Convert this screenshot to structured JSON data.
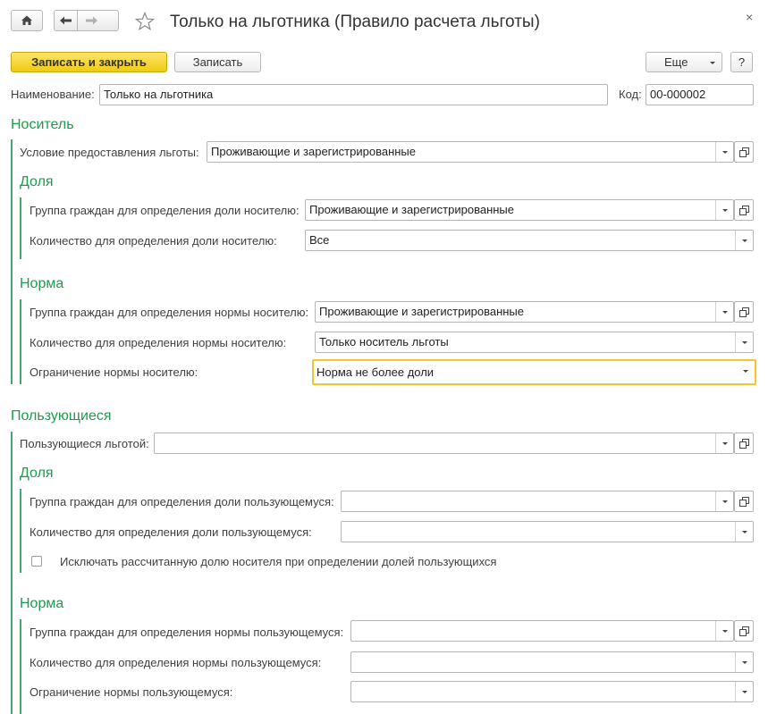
{
  "window": {
    "title": "Только на льготника (Правило расчета льготы)",
    "close_glyph": "×"
  },
  "toolbar": {
    "save_close_label": "Записать и закрыть",
    "save_label": "Записать",
    "more_label": "Еще",
    "help_label": "?"
  },
  "header_fields": {
    "name_label": "Наименование:",
    "name_value": "Только на льготника",
    "code_label": "Код:",
    "code_value": "00-000002"
  },
  "carrier": {
    "section_title": "Носитель",
    "condition_label": "Условие предоставления льготы:",
    "condition_value": "Проживающие и зарегистрированные",
    "share": {
      "title": "Доля",
      "group_label": "Группа граждан для определения доли носителю:",
      "group_value": "Проживающие и зарегистрированные",
      "count_label": "Количество для определения доли носителю:",
      "count_value": "Все"
    },
    "norm": {
      "title": "Норма",
      "group_label": "Группа граждан для определения нормы носителю:",
      "group_value": "Проживающие и зарегистрированные",
      "count_label": "Количество для определения нормы носителю:",
      "count_value": "Только носитель льготы",
      "limit_label": "Ограничение нормы носителю:",
      "limit_value": "Норма не более доли"
    }
  },
  "users": {
    "section_title": "Пользующиеся",
    "users_label": "Пользующиеся льготой:",
    "users_value": "",
    "share": {
      "title": "Доля",
      "group_label": "Группа граждан для определения доли пользующемуся:",
      "group_value": "",
      "count_label": "Количество для определения доли пользующемуся:",
      "count_value": "",
      "exclude_label": "Исключать рассчитанную долю носителя при определении долей пользующихся",
      "exclude_checked": false
    },
    "norm": {
      "title": "Норма",
      "group_label": "Группа граждан для определения нормы пользующемуся:",
      "group_value": "",
      "count_label": "Количество для определения нормы пользующемуся:",
      "count_value": "",
      "limit_label": "Ограничение нормы пользующемуся:",
      "limit_value": ""
    }
  },
  "colors": {
    "section_green": "#1e9b4d",
    "primary_yellow": "#f4d12a",
    "active_border": "#f2c631"
  },
  "icons": [
    "home-icon",
    "back-arrow-icon",
    "forward-arrow-icon",
    "star-icon",
    "close-icon",
    "dropdown-arrow-icon",
    "open-form-icon",
    "more-chevron-icon"
  ]
}
